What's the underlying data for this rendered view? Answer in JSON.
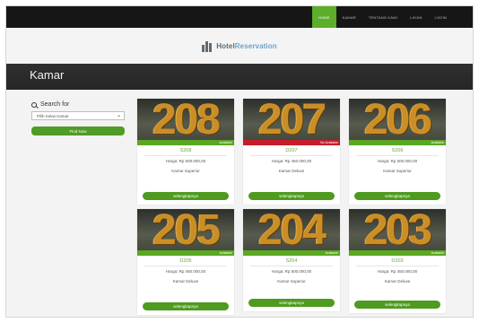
{
  "nav": {
    "items": [
      {
        "label": "HOME",
        "active": true
      },
      {
        "label": "KAMAR",
        "active": false
      },
      {
        "label": "TENTANG KAMI",
        "active": false
      },
      {
        "label": "LAYAN",
        "active": false
      },
      {
        "label": "LOGIN",
        "active": false
      }
    ]
  },
  "logo": {
    "part1": "Hotel",
    "part2": "Reservation",
    "icon": "building-icon"
  },
  "page": {
    "title": "Kamar"
  },
  "sidebar": {
    "search_label": "Search for",
    "select_value": "Pilih Kelas Kamar",
    "find_button": "Find Now"
  },
  "rooms": [
    {
      "number": "208",
      "status": "Available",
      "code": "S208",
      "price": "Harga: Rp 500.000,00",
      "type": "Kamar Superior",
      "button": "selengkapnya"
    },
    {
      "number": "207",
      "status": "No Available",
      "code": "D207",
      "price": "Harga: Rp 450.000,00",
      "type": "Kamar Deluxe",
      "button": "selengkapnya"
    },
    {
      "number": "206",
      "status": "Available",
      "code": "S206",
      "price": "Harga: Rp 500.000,00",
      "type": "Kamar Superior",
      "button": "selengkapnya"
    },
    {
      "number": "205",
      "status": "Available",
      "code": "D205",
      "price": "Harga: Rp 450.000,00",
      "type": "Kamar Deluxe",
      "button": "selengkapnya"
    },
    {
      "number": "204",
      "status": "Available",
      "code": "S204",
      "price": "Harga: Rp 500.000,00",
      "type": "Kamar Superior",
      "button": "selengkapnya"
    },
    {
      "number": "203",
      "status": "Available",
      "code": "D203",
      "price": "Harga: Rp 450.000,00",
      "type": "Kamar Deluxe",
      "button": "selengkapnya"
    }
  ],
  "colors": {
    "accent_green": "#5cae2b",
    "unavailable_red": "#c51d2c",
    "nav_bg": "#161616",
    "title_band": "#2b2b2b"
  }
}
